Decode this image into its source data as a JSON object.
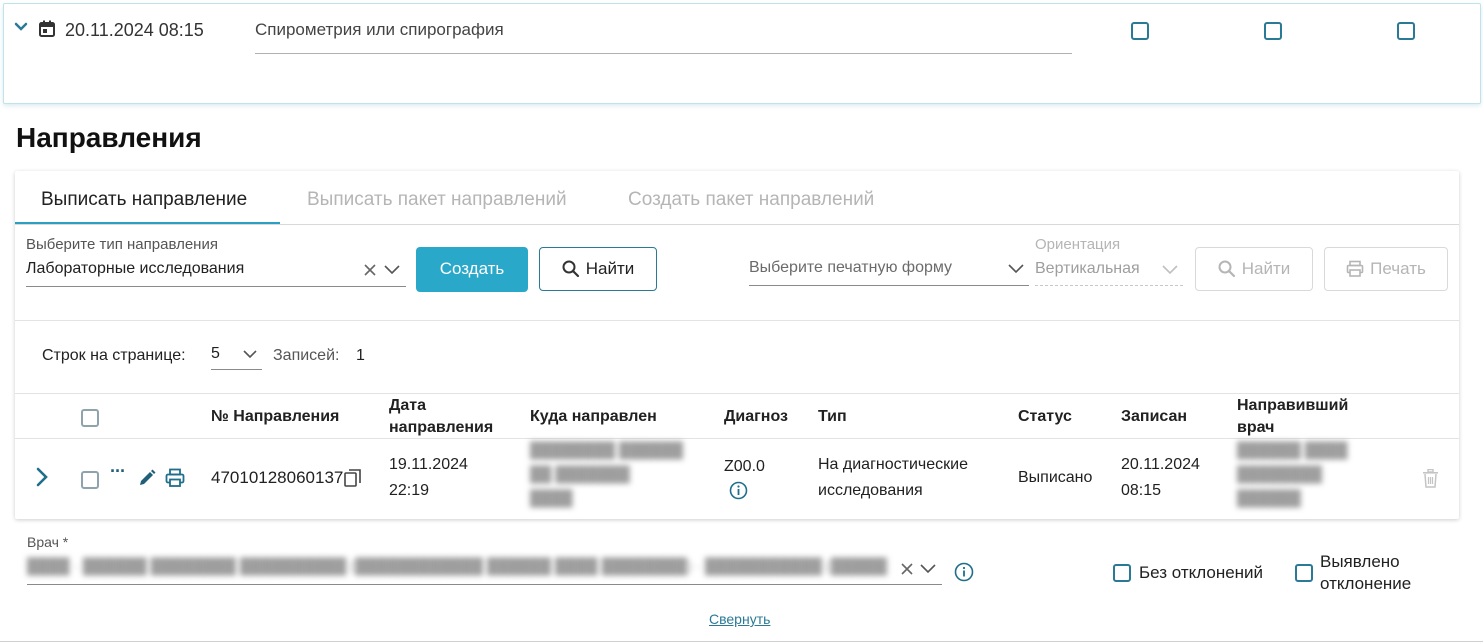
{
  "top_row": {
    "datetime": "20.11.2024 08:15",
    "service_name": "Спирометрия или спирография"
  },
  "section": {
    "title": "Направления"
  },
  "tabs": [
    {
      "label": "Выписать направление",
      "active": true
    },
    {
      "label": "Выписать пакет направлений",
      "active": false
    },
    {
      "label": "Создать пакет направлений",
      "active": false
    }
  ],
  "form": {
    "type_label": "Выберите тип направления",
    "type_value": "Лабораторные исследования",
    "create_label": "Создать",
    "find_label": "Найти",
    "print_form_placeholder": "Выберите печатную форму",
    "orientation_label": "Ориентация",
    "orientation_value": "Вертикальная",
    "find2_label": "Найти",
    "print_label": "Печать"
  },
  "pagination": {
    "rows_label": "Строк на странице:",
    "rows_value": "5",
    "records_label": "Записей:",
    "records_value": "1"
  },
  "table": {
    "headers": {
      "number": "№ Направления",
      "date_l1": "Дата",
      "date_l2": "направления",
      "where": "Куда направлен",
      "diagnosis": "Диагноз",
      "type": "Тип",
      "status": "Статус",
      "recorded": "Записан",
      "doctor_l1": "Направивший",
      "doctor_l2": "врач"
    },
    "row": {
      "number": "47010128060137",
      "date_l1": "19.11.2024",
      "date_l2": "22:19",
      "diagnosis": "Z00.0",
      "type_l1": "На диагностические",
      "type_l2": "исследования",
      "status": "Выписано",
      "recorded_l1": "20.11.2024",
      "recorded_l2": "08:15",
      "ellipsis": "···"
    }
  },
  "doctor_field": {
    "label": "Врач *"
  },
  "checkboxes": {
    "no_deviation": "Без отклонений",
    "deviation_l1": "Выявлено",
    "deviation_l2": "отклонение"
  },
  "collapse_link": "Свернуть",
  "colors": {
    "accent": "#2aa8c9",
    "border_accent": "#2a7a96",
    "disabled": "#b5b5b5"
  }
}
